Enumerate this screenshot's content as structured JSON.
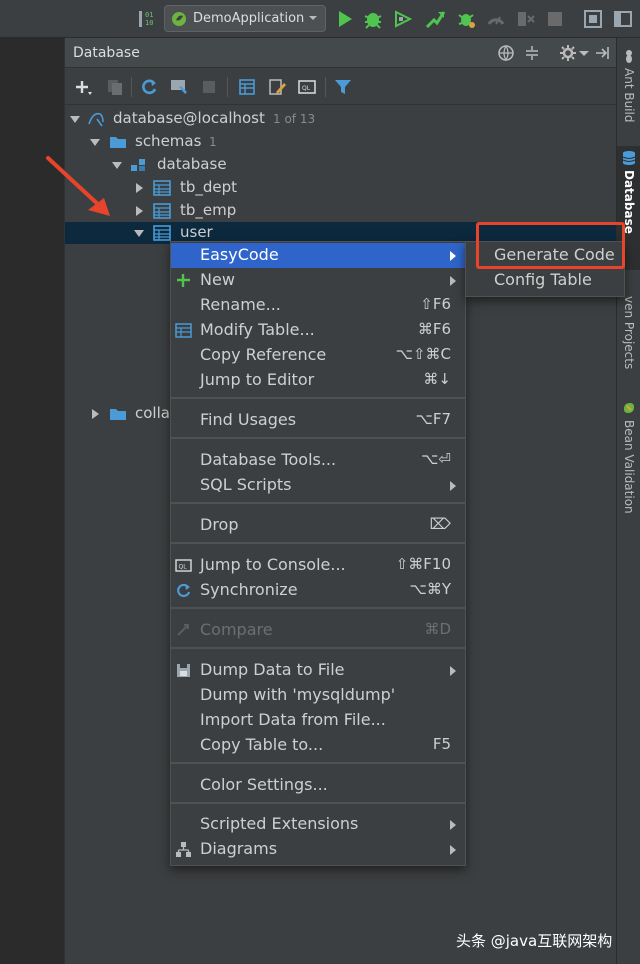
{
  "toolbar": {
    "run_configuration": "DemoApplication",
    "icons": [
      "build-icon",
      "run-config-icon",
      "run-icon",
      "debug-icon",
      "coverage-icon",
      "profile-icon",
      "bug-icon",
      "gauge-icon",
      "stop-icon",
      "project-structure-icon",
      "layout-icon"
    ]
  },
  "panel": {
    "title": "Database",
    "header_icons": [
      "globe-icon",
      "collapse-icon",
      "gear-icon",
      "hide-icon"
    ],
    "toolbar_icons": [
      "add-icon",
      "copy-icon",
      "refresh-icon",
      "properties-icon",
      "stop-icon",
      "table-icon",
      "edit-icon",
      "console-icon",
      "filter-icon"
    ]
  },
  "tree": {
    "datasource": {
      "label": "database@localhost",
      "hint": "1 of 13"
    },
    "schemas": {
      "label": "schemas",
      "hint": "1"
    },
    "schema_database": {
      "label": "database"
    },
    "tables": [
      {
        "label": "tb_dept"
      },
      {
        "label": "tb_emp"
      },
      {
        "label": "user"
      }
    ],
    "collations": {
      "label": "colla"
    }
  },
  "context_menu": {
    "items": [
      {
        "label": "EasyCode",
        "shortcut": "",
        "submenu": true
      },
      {
        "label": "New",
        "shortcut": "",
        "submenu": true
      },
      {
        "label": "Rename...",
        "shortcut": "⇧F6"
      },
      {
        "label": "Modify Table...",
        "shortcut": "⌘F6"
      },
      {
        "label": "Copy Reference",
        "shortcut": "⌥⇧⌘C"
      },
      {
        "label": "Jump to Editor",
        "shortcut": "⌘↓"
      },
      {
        "label": "Find Usages",
        "shortcut": "⌥F7"
      },
      {
        "label": "Database Tools...",
        "shortcut": "⌥⏎"
      },
      {
        "label": "SQL Scripts",
        "shortcut": "",
        "submenu": true
      },
      {
        "label": "Drop",
        "shortcut": "⌦"
      },
      {
        "label": "Jump to Console...",
        "shortcut": "⇧⌘F10"
      },
      {
        "label": "Synchronize",
        "shortcut": "⌥⌘Y"
      },
      {
        "label": "Compare",
        "shortcut": "⌘D",
        "disabled": true
      },
      {
        "label": "Dump Data to File",
        "shortcut": "",
        "submenu": true
      },
      {
        "label": "Dump with 'mysqldump'",
        "shortcut": ""
      },
      {
        "label": "Import Data from File...",
        "shortcut": ""
      },
      {
        "label": "Copy Table to...",
        "shortcut": "F5"
      },
      {
        "label": "Color Settings...",
        "shortcut": ""
      },
      {
        "label": "Scripted Extensions",
        "shortcut": "",
        "submenu": true
      },
      {
        "label": "Diagrams",
        "shortcut": "",
        "submenu": true
      }
    ]
  },
  "submenu": {
    "items": [
      {
        "label": "Generate Code"
      },
      {
        "label": "Config Table"
      }
    ]
  },
  "right_stripe": {
    "tabs": [
      {
        "label": "Ant Build"
      },
      {
        "label": "Database"
      },
      {
        "label": "ven Projects"
      },
      {
        "label": "Bean Validation"
      }
    ]
  },
  "watermark": "头条 @java互联网架构",
  "colors": {
    "background": "#3c3f41",
    "selection": "#2f65ca",
    "annotation": "#e8442b",
    "table_icon": "#4a9bd6"
  }
}
